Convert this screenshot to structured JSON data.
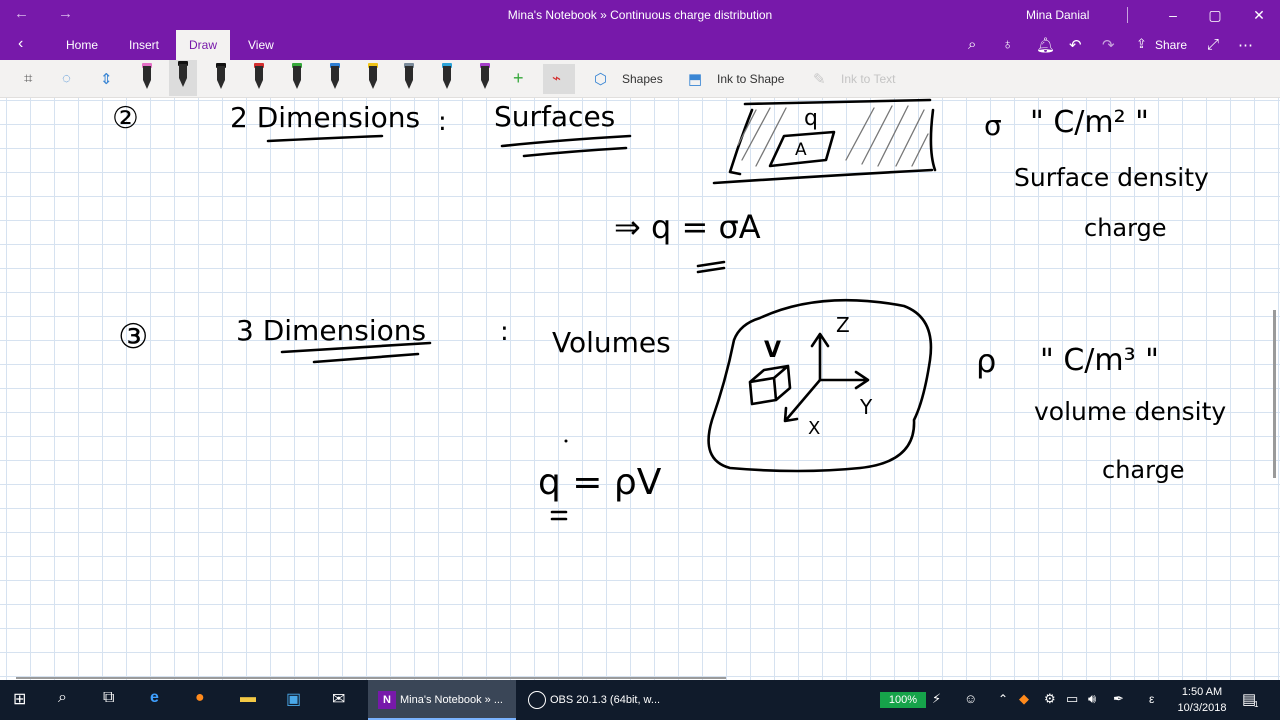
{
  "titlebar": {
    "title": "Mina's Notebook » Continuous charge distribution",
    "user": "Mina Danial",
    "back_icon": "back-arrow-icon",
    "forward_icon": "forward-arrow-icon"
  },
  "ribbon": {
    "tabs": [
      "Home",
      "Insert",
      "Draw",
      "View"
    ],
    "active_tab": "Draw",
    "share_label": "Share"
  },
  "toolbar": {
    "shapes_label": "Shapes",
    "ink_to_shape_label": "Ink to Shape",
    "ink_to_text_label": "Ink to Text",
    "pen_colors": [
      "#e46fc6",
      "#111111",
      "#111111",
      "#d42f2f",
      "#35a83a",
      "#2f7fd4",
      "#f0c418",
      "#7a8a9a",
      "#2ba3d9",
      "#a43dc9"
    ]
  },
  "notes": {
    "s2_num": "②",
    "s2_title": "2 Dimensions",
    "colon": ":",
    "s2_kind": "Surfaces",
    "s2_sym": "σ",
    "s2_unit": "\" C/m² \"",
    "s2_desc1": "Surface density",
    "s2_desc2": "charge",
    "s2_eq": "⇒  q = σA",
    "fig2_q": "q",
    "fig2_a": "A",
    "s3_num": "③",
    "s3_title": "3 Dimensions",
    "s3_kind": "Volumes",
    "s3_sym": "ρ",
    "s3_unit": "\" C/m³ \"",
    "s3_desc1": "volume density",
    "s3_desc2": "charge",
    "s3_eq": "q = ρV",
    "fig3_v": "V",
    "fig3_z": "Z",
    "fig3_y": "Y",
    "fig3_x": "X"
  },
  "taskbar": {
    "onenote_label": "Mina's Notebook » ...",
    "obs_label": "OBS 20.1.3 (64bit, w...",
    "battery": "100%",
    "time": "1:50 AM",
    "date": "10/3/2018",
    "notification_count": "1"
  }
}
